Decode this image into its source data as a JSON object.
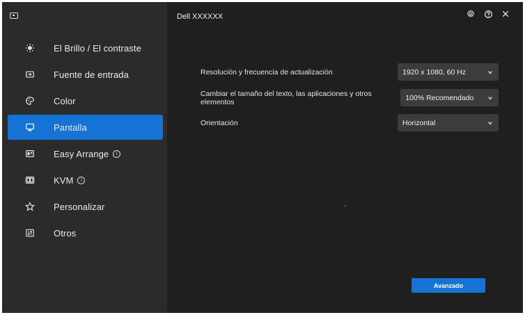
{
  "window": {
    "title": "Dell XXXXXX"
  },
  "sidebar": {
    "items": [
      {
        "label": "El Brillo / El contraste",
        "icon": "brightness-icon",
        "active": false,
        "info": false
      },
      {
        "label": "Fuente de entrada",
        "icon": "input-source-icon",
        "active": false,
        "info": false
      },
      {
        "label": "Color",
        "icon": "color-palette-icon",
        "active": false,
        "info": false
      },
      {
        "label": "Pantalla",
        "icon": "display-icon",
        "active": true,
        "info": false
      },
      {
        "label": "Easy Arrange",
        "icon": "easy-arrange-icon",
        "active": false,
        "info": true
      },
      {
        "label": "KVM",
        "icon": "kvm-icon",
        "active": false,
        "info": true
      },
      {
        "label": "Personalizar",
        "icon": "star-icon",
        "active": false,
        "info": false
      },
      {
        "label": "Otros",
        "icon": "others-icon",
        "active": false,
        "info": false
      }
    ]
  },
  "settings": {
    "resolution": {
      "label": "Resolución y frecuencia de actualización",
      "value": "1920 x 1080, 60 Hz"
    },
    "scale": {
      "label": "Cambiar el tamaño del texto, las aplicaciones y otros elementos",
      "value": "100% Recomendado"
    },
    "orientation": {
      "label": "Orientación",
      "value": "Horizontal"
    }
  },
  "advanced_button": {
    "label": "Avanzado"
  },
  "colors": {
    "accent": "#1473d4",
    "sidebar_bg": "#2b2b2b",
    "main_bg": "#1f1f1f",
    "dropdown_bg": "#3c3c3c"
  }
}
